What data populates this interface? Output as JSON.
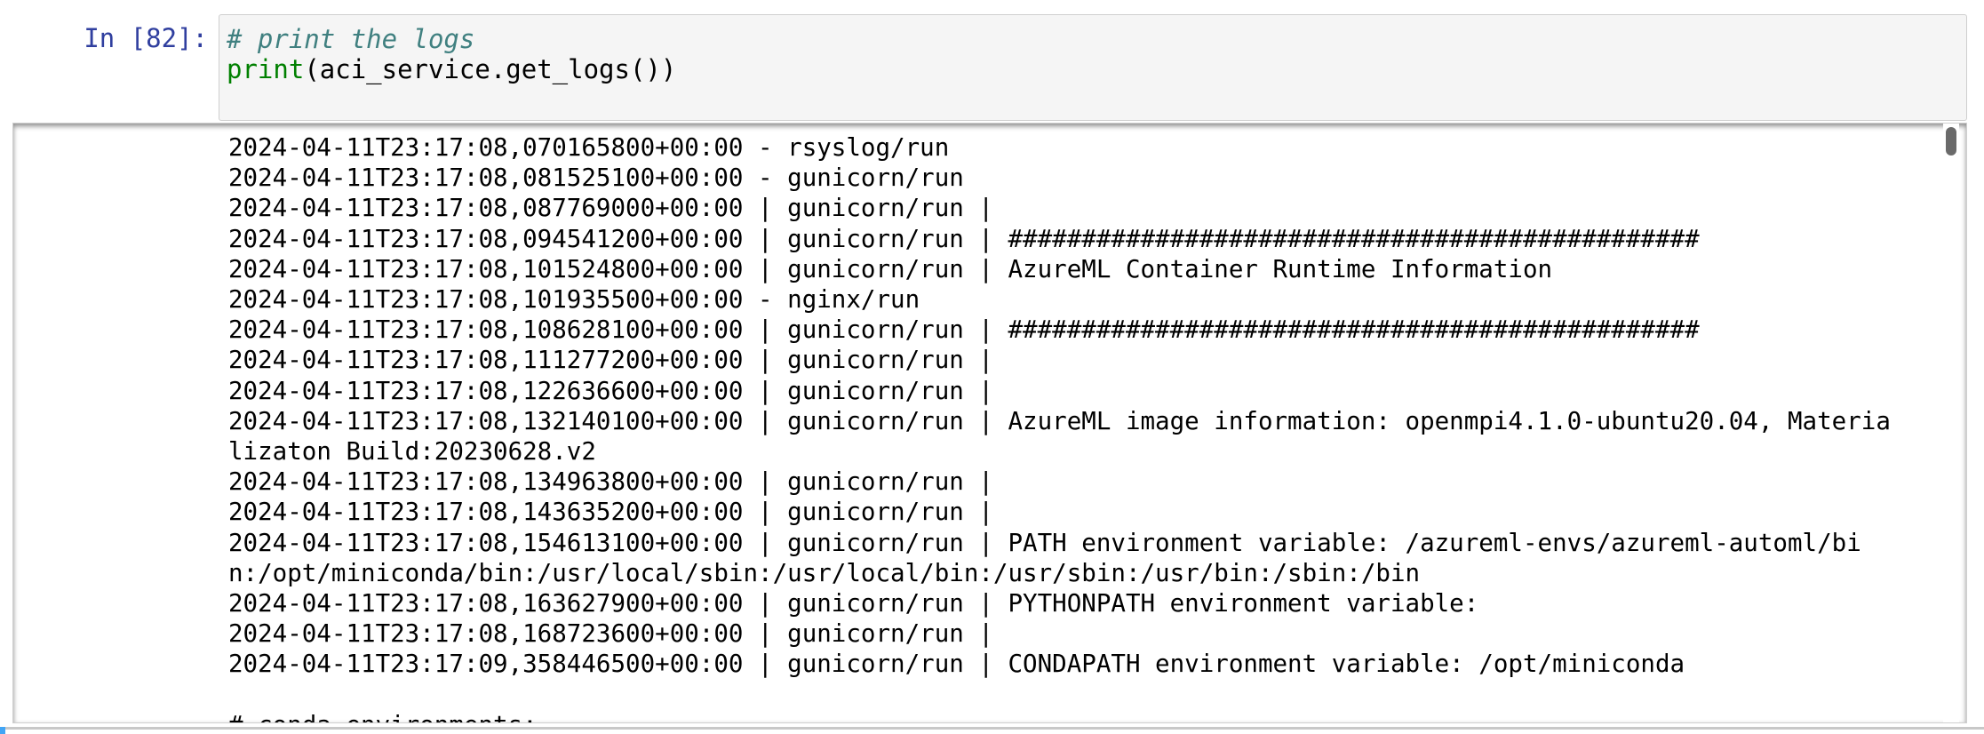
{
  "cell": {
    "prompt": "In [82]:",
    "code": {
      "comment": "# print the logs",
      "func": "print",
      "args": "(aci_service.get_logs())"
    }
  },
  "output": {
    "lines": [
      "2024-04-11T23:17:08,070165800+00:00 - rsyslog/run",
      "2024-04-11T23:17:08,081525100+00:00 - gunicorn/run",
      "2024-04-11T23:17:08,087769000+00:00 | gunicorn/run |",
      "2024-04-11T23:17:08,094541200+00:00 | gunicorn/run | ###############################################",
      "2024-04-11T23:17:08,101524800+00:00 | gunicorn/run | AzureML Container Runtime Information",
      "2024-04-11T23:17:08,101935500+00:00 - nginx/run",
      "2024-04-11T23:17:08,108628100+00:00 | gunicorn/run | ###############################################",
      "2024-04-11T23:17:08,111277200+00:00 | gunicorn/run |",
      "2024-04-11T23:17:08,122636600+00:00 | gunicorn/run |",
      "2024-04-11T23:17:08,132140100+00:00 | gunicorn/run | AzureML image information: openmpi4.1.0-ubuntu20.04, Materia",
      "lizaton Build:20230628.v2",
      "2024-04-11T23:17:08,134963800+00:00 | gunicorn/run |",
      "2024-04-11T23:17:08,143635200+00:00 | gunicorn/run |",
      "2024-04-11T23:17:08,154613100+00:00 | gunicorn/run | PATH environment variable: /azureml-envs/azureml-automl/bi",
      "n:/opt/miniconda/bin:/usr/local/sbin:/usr/local/bin:/usr/sbin:/usr/bin:/sbin:/bin",
      "2024-04-11T23:17:08,163627900+00:00 | gunicorn/run | PYTHONPATH environment variable:",
      "2024-04-11T23:17:08,168723600+00:00 | gunicorn/run |",
      "2024-04-11T23:17:09,358446500+00:00 | gunicorn/run | CONDAPATH environment variable: /opt/miniconda",
      "",
      "# conda environments:"
    ]
  }
}
